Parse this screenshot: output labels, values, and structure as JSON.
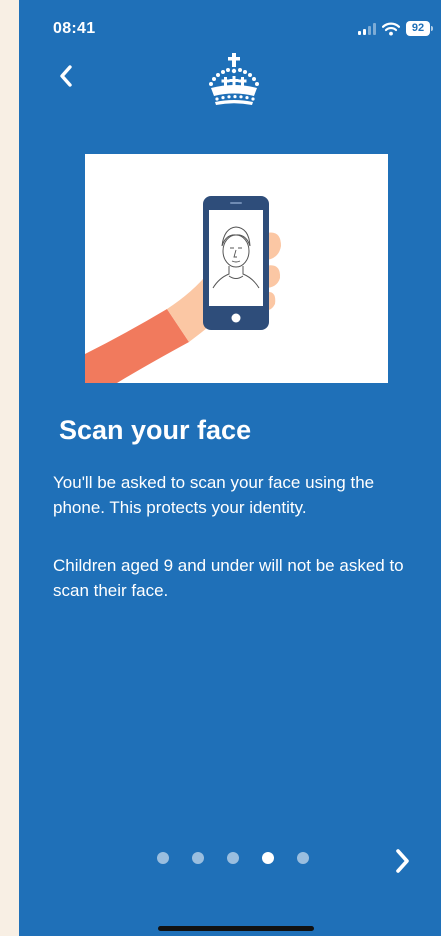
{
  "status_bar": {
    "time": "08:41",
    "battery_level": "92",
    "signal_icon": "cellular-signal-icon",
    "wifi_icon": "wifi-icon"
  },
  "header": {
    "back_icon": "chevron-left-icon",
    "logo_icon": "crown-logo-icon"
  },
  "illustration": {
    "description_icon": "face-scan-phone-illustration"
  },
  "content": {
    "title": "Scan your face",
    "paragraph_1": "You'll be asked to scan your face using the phone. This protects your identity.",
    "paragraph_2": "Children aged 9 and under will not be asked to scan their face."
  },
  "pagination": {
    "total_pages": 5,
    "current_page": 4
  },
  "footer": {
    "next_icon": "chevron-right-icon"
  },
  "colors": {
    "background": "#1f70b8",
    "text": "#ffffff",
    "page_outer": "#f8efe4",
    "illustration_sleeve": "#f17a5d",
    "illustration_hand": "#fbc7a4",
    "phone_frame": "#2e4d7a"
  }
}
